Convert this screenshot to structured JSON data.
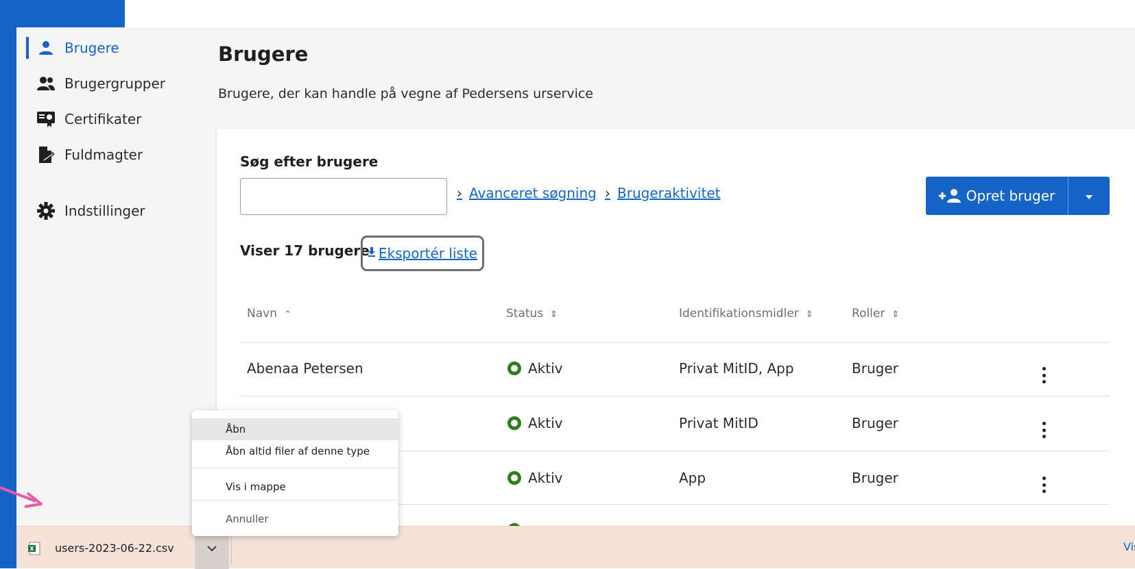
{
  "sidebar": {
    "items": [
      {
        "label": "Brugere",
        "icon": "person-icon",
        "active": true
      },
      {
        "label": "Brugergrupper",
        "icon": "people-icon"
      },
      {
        "label": "Certifikater",
        "icon": "certificate-icon"
      },
      {
        "label": "Fuldmagter",
        "icon": "document-pen-icon"
      },
      {
        "label": "Indstillinger",
        "icon": "gear-icon"
      }
    ]
  },
  "main": {
    "title": "Brugere",
    "subtitle": "Brugere, der kan handle på vegne af Pedersens urservice",
    "search_label": "Søg efter brugere",
    "search_value": "",
    "search_placeholder": "",
    "links": {
      "advanced_search": "Avanceret søgning",
      "user_activity": "Brugeraktivitet"
    },
    "create_button": "Opret bruger",
    "count_label": "Viser 17 brugere",
    "export_label": "Eksportér liste",
    "table": {
      "headers": [
        "Navn",
        "Status",
        "Identifikationsmidler",
        "Roller"
      ],
      "rows": [
        {
          "name": "Abenaa Petersen",
          "status": "Aktiv",
          "id": "Privat MitID, App",
          "role": "Bruger"
        },
        {
          "name": "",
          "status": "Aktiv",
          "id": "Privat MitID",
          "role": "Bruger"
        },
        {
          "name": "",
          "status": "Aktiv",
          "id": "App",
          "role": "Bruger"
        }
      ]
    }
  },
  "context_menu": {
    "items": [
      "Åbn",
      "Åbn altid filer af denne type",
      "Vis i mappe",
      "Annuller"
    ]
  },
  "download_bar": {
    "filename": "users-2023-06-22.csv",
    "show_all": "Vis"
  },
  "colors": {
    "accent": "#1565c8",
    "status_active": "#2f7d1f",
    "download_bar": "#f5e3da",
    "arrow": "#e85aa5"
  }
}
